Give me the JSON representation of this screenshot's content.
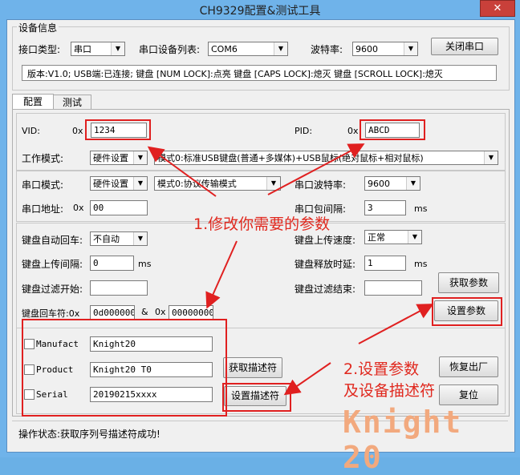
{
  "window": {
    "title": "CH9329配置&测试工具",
    "close_label": "✕"
  },
  "device_info": {
    "legend": "设备信息",
    "port_type_label": "接口类型:",
    "port_type_value": "串口",
    "port_list_label": "串口设备列表:",
    "port_list_value": "COM6",
    "baud_label": "波特率:",
    "baud_value": "9600",
    "close_port_button": "关闭串口",
    "status_line": "版本:V1.0;  USB端:已连接;  键盘 [NUM LOCK]:点亮  键盘 [CAPS LOCK]:熄灭  键盘 [SCROLL LOCK]:熄灭"
  },
  "tabs": [
    {
      "label": "配置"
    },
    {
      "label": "测试"
    }
  ],
  "config": {
    "vid_label": "VID:",
    "vid_prefix": "0x",
    "vid_value": "1234",
    "pid_label": "PID:",
    "pid_prefix": "0x",
    "pid_value": "ABCD",
    "work_mode_label": "工作模式:",
    "work_mode_value": "硬件设置",
    "work_mode_detail": "模式0:标准USB键盘(普通+多媒体)+USB鼠标(绝对鼠标+相对鼠标)",
    "serial_mode_label": "串口模式:",
    "serial_mode_value": "硬件设置",
    "serial_mode_detail": "模式0:协议传输模式",
    "serial_baud_label": "串口波特率:",
    "serial_baud_value": "9600",
    "serial_addr_label": "串口地址:",
    "serial_addr_prefix": "0x",
    "serial_addr_value": "00",
    "packet_interval_label": "串口包间隔:",
    "packet_interval_value": "3",
    "packet_interval_unit": "ms",
    "kb_auto_enter_label": "键盘自动回车:",
    "kb_auto_enter_value": "不自动",
    "kb_upload_speed_label": "键盘上传速度:",
    "kb_upload_speed_value": "正常",
    "kb_upload_interval_label": "键盘上传间隔:",
    "kb_upload_interval_value": "0",
    "kb_upload_interval_unit": "ms",
    "kb_release_delay_label": "键盘释放时延:",
    "kb_release_delay_value": "1",
    "kb_release_delay_unit": "ms",
    "kb_filter_start_label": "键盘过滤开始:",
    "kb_filter_start_value": "",
    "kb_filter_end_label": "键盘过滤结束:",
    "kb_filter_end_value": "",
    "get_params_button": "获取参数",
    "kb_enter_char_label": "键盘回车符:0x",
    "kb_enter_char_value1": "0d000000",
    "kb_enter_amp": "&",
    "kb_enter_prefix2": "0x",
    "kb_enter_char_value2": "00000000",
    "set_params_button": "设置参数",
    "manufact_label": "Manufact",
    "manufact_value": "Knight20",
    "product_label": "Product",
    "product_value": "Knight20 T0",
    "serial_label": "Serial",
    "serial_value": "20190215xxxx",
    "get_desc_button": "获取描述符",
    "set_desc_button": "设置描述符",
    "restore_button": "恢复出厂",
    "reset_button": "复位"
  },
  "status_bar": {
    "text": "操作状态:获取序列号描述符成功!"
  },
  "annotations": {
    "step1": "1.修改你需要的参数",
    "step2_line1": "2.设置参数",
    "step2_line2": "及设备描述符"
  },
  "watermark": "Knight 20",
  "colors": {
    "annotation_red": "#e02020",
    "title_bar": "#6fb3ea",
    "watermark": "#f2a97e"
  }
}
